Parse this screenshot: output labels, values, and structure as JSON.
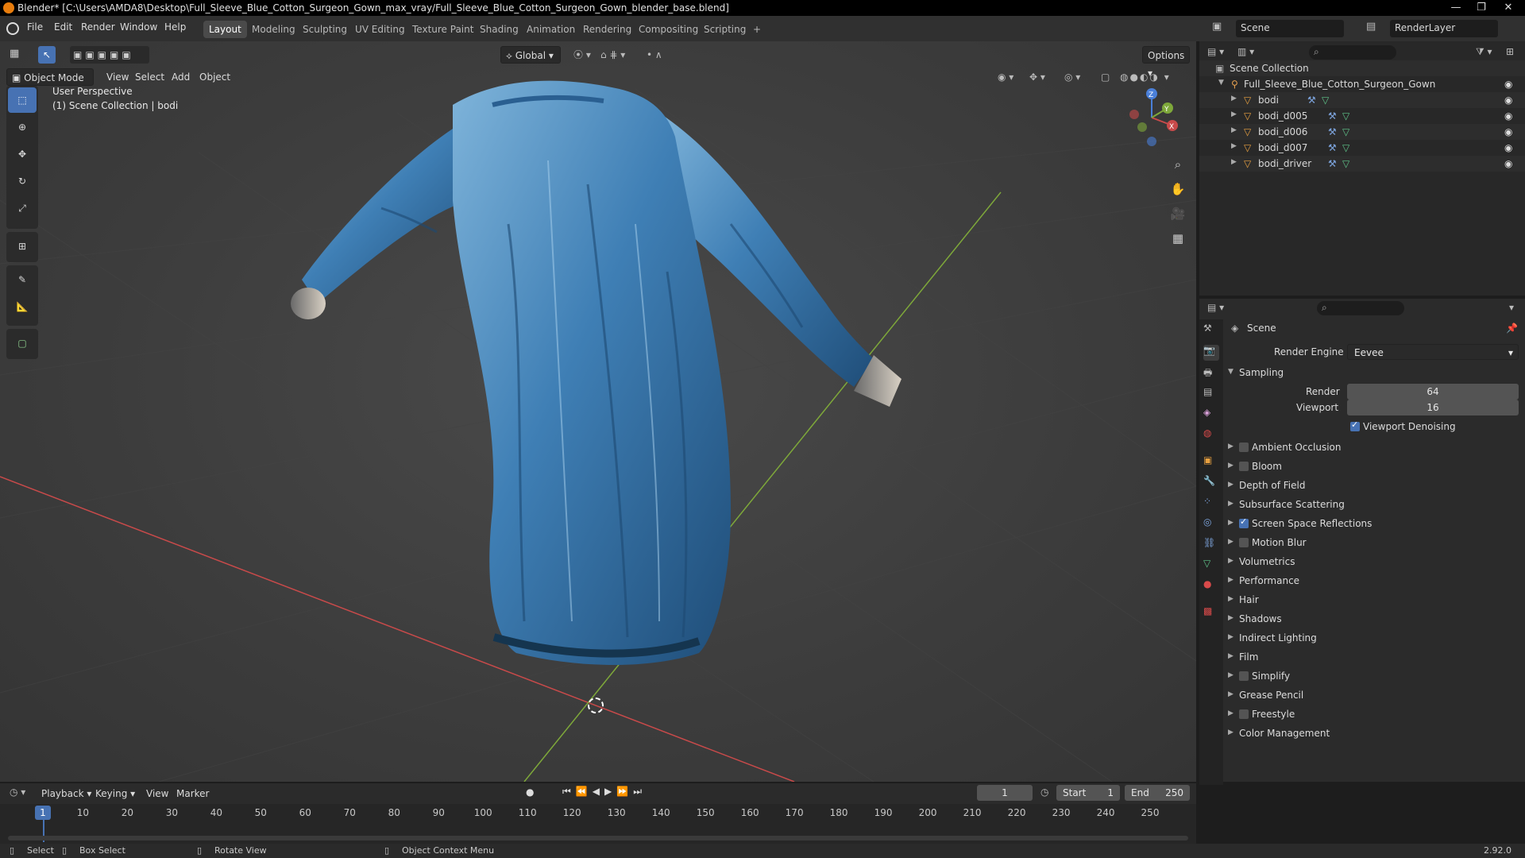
{
  "window": {
    "title": "Blender* [C:\\Users\\AMDA8\\Desktop\\Full_Sleeve_Blue_Cotton_Surgeon_Gown_max_vray/Full_Sleeve_Blue_Cotton_Surgeon_Gown_blender_base.blend]",
    "minimize": "—",
    "maximize": "❐",
    "close": "✕"
  },
  "menu": [
    "File",
    "Edit",
    "Render",
    "Window",
    "Help"
  ],
  "workspaces": [
    "Layout",
    "Modeling",
    "Sculpting",
    "UV Editing",
    "Texture Paint",
    "Shading",
    "Animation",
    "Rendering",
    "Compositing",
    "Scripting",
    "+"
  ],
  "active_workspace": "Layout",
  "scene": {
    "name": "Scene",
    "view_layer": "RenderLayer"
  },
  "viewport": {
    "transform_orientation": "Global",
    "options_label": "Options",
    "mode": "Object Mode",
    "menus": [
      "View",
      "Select",
      "Add",
      "Object"
    ],
    "overlay_line1": "User Perspective",
    "overlay_line2": "(1) Scene Collection | bodi",
    "gizmo_axes": {
      "x": "X",
      "y": "Y",
      "z": "Z"
    }
  },
  "outliner": {
    "root": "Scene Collection",
    "collection": "Full_Sleeve_Blue_Cotton_Surgeon_Gown",
    "objects": [
      "bodi",
      "bodi_d005",
      "bodi_d006",
      "bodi_d007",
      "bodi_driver"
    ]
  },
  "properties": {
    "header": "Scene",
    "render_engine_label": "Render Engine",
    "render_engine": "Eevee",
    "sampling": {
      "title": "Sampling",
      "render_label": "Render",
      "render": "64",
      "viewport_label": "Viewport",
      "viewport": "16",
      "denoise_label": "Viewport Denoising"
    },
    "panels": [
      {
        "label": "Ambient Occlusion",
        "checkbox": true,
        "checked": false
      },
      {
        "label": "Bloom",
        "checkbox": true,
        "checked": false
      },
      {
        "label": "Depth of Field",
        "checkbox": false,
        "checked": false
      },
      {
        "label": "Subsurface Scattering",
        "checkbox": false,
        "checked": false
      },
      {
        "label": "Screen Space Reflections",
        "checkbox": true,
        "checked": true
      },
      {
        "label": "Motion Blur",
        "checkbox": true,
        "checked": false
      },
      {
        "label": "Volumetrics",
        "checkbox": false,
        "checked": false
      },
      {
        "label": "Performance",
        "checkbox": false,
        "checked": false
      },
      {
        "label": "Hair",
        "checkbox": false,
        "checked": false
      },
      {
        "label": "Shadows",
        "checkbox": false,
        "checked": false
      },
      {
        "label": "Indirect Lighting",
        "checkbox": false,
        "checked": false
      },
      {
        "label": "Film",
        "checkbox": false,
        "checked": false
      },
      {
        "label": "Simplify",
        "checkbox": true,
        "checked": false
      },
      {
        "label": "Grease Pencil",
        "checkbox": false,
        "checked": false
      },
      {
        "label": "Freestyle",
        "checkbox": true,
        "checked": false
      },
      {
        "label": "Color Management",
        "checkbox": false,
        "checked": false
      }
    ]
  },
  "timeline": {
    "menus": [
      "Playback",
      "Keying",
      "View",
      "Marker"
    ],
    "current_frame": "1",
    "start_label": "Start",
    "start": "1",
    "end_label": "End",
    "end": "250",
    "ticks": [
      "1",
      "10",
      "20",
      "30",
      "40",
      "50",
      "60",
      "70",
      "80",
      "90",
      "100",
      "110",
      "120",
      "130",
      "140",
      "150",
      "160",
      "170",
      "180",
      "190",
      "200",
      "210",
      "220",
      "230",
      "240",
      "250"
    ]
  },
  "status": {
    "select": "Select",
    "box_select": "Box Select",
    "rotate": "Rotate View",
    "context": "Object Context Menu",
    "version": "2.92.0"
  },
  "colors": {
    "accent": "#4772b3",
    "gown": "#3f7fb5",
    "x_axis": "#c84a4a",
    "y_axis": "#7ea83a"
  }
}
